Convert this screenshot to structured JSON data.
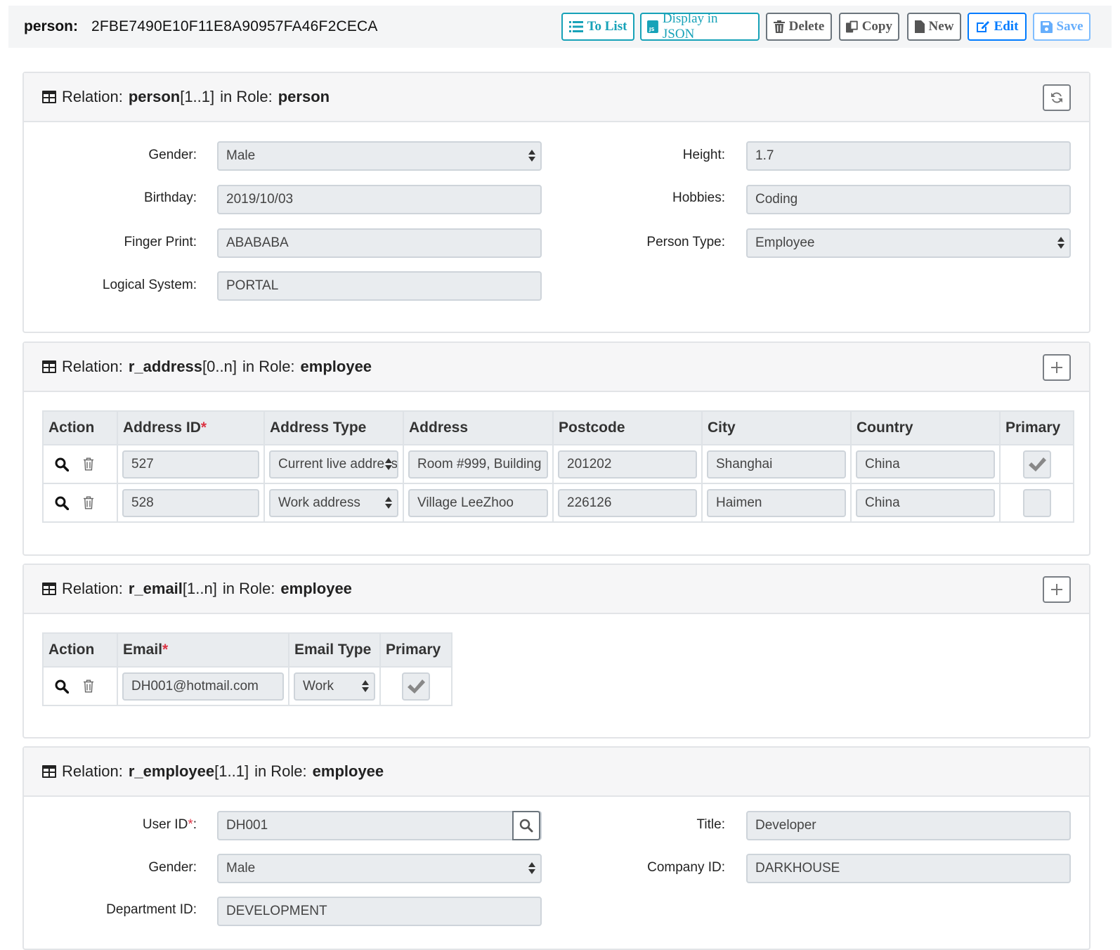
{
  "header": {
    "object_label": "person:",
    "object_id": "2FBE7490E10F11E8A90957FA46F2CECA",
    "buttons": {
      "to_list": "To List",
      "display_json": "Display in JSON",
      "delete": "Delete",
      "copy": "Copy",
      "new": "New",
      "edit": "Edit",
      "save": "Save"
    }
  },
  "relations": {
    "person": {
      "prefix": "Relation:",
      "name": "person",
      "cardinality": "[1..1]",
      "role_prefix": "in Role:",
      "role": "person",
      "fields": {
        "gender_label": "Gender:",
        "gender": "Male",
        "height_label": "Height:",
        "height": "1.7",
        "birthday_label": "Birthday:",
        "birthday": "2019/10/03",
        "hobbies_label": "Hobbies:",
        "hobbies": "Coding",
        "finger_print_label": "Finger Print:",
        "finger_print": "ABABABA",
        "person_type_label": "Person Type:",
        "person_type": "Employee",
        "logical_system_label": "Logical System:",
        "logical_system": "PORTAL"
      }
    },
    "address": {
      "prefix": "Relation:",
      "name": "r_address",
      "cardinality": "[0..n]",
      "role_prefix": "in Role:",
      "role": "employee",
      "columns": {
        "action": "Action",
        "address_id": "Address ID",
        "address_type": "Address Type",
        "address": "Address",
        "postcode": "Postcode",
        "city": "City",
        "country": "Country",
        "primary": "Primary"
      },
      "required_mark": "*",
      "rows": [
        {
          "address_id": "527",
          "address_type": "Current live address",
          "address": "Room #999, Building",
          "postcode": "201202",
          "city": "Shanghai",
          "country": "China",
          "primary": true
        },
        {
          "address_id": "528",
          "address_type": "Work address",
          "address": "Village LeeZhoo",
          "postcode": "226126",
          "city": "Haimen",
          "country": "China",
          "primary": false
        }
      ]
    },
    "email": {
      "prefix": "Relation:",
      "name": "r_email",
      "cardinality": "[1..n]",
      "role_prefix": "in Role:",
      "role": "employee",
      "columns": {
        "action": "Action",
        "email": "Email",
        "email_type": "Email Type",
        "primary": "Primary"
      },
      "required_mark": "*",
      "rows": [
        {
          "email": "DH001@hotmail.com",
          "email_type": "Work",
          "primary": true
        }
      ]
    },
    "employee": {
      "prefix": "Relation:",
      "name": "r_employee",
      "cardinality": "[1..1]",
      "role_prefix": "in Role:",
      "role": "employee",
      "fields": {
        "user_id_label": "User ID",
        "user_id_required": "*",
        "user_id_colon": ":",
        "user_id": "DH001",
        "title_label": "Title:",
        "title": "Developer",
        "gender_label": "Gender:",
        "gender": "Male",
        "company_id_label": "Company ID:",
        "company_id": "DARKHOUSE",
        "department_id_label": "Department ID:",
        "department_id": "DEVELOPMENT"
      }
    }
  },
  "icons": {
    "table": "table-icon",
    "list": "list-icon",
    "json": "json-icon",
    "trash": "trash-icon",
    "copy": "copy-icon",
    "file": "file-icon",
    "edit": "edit-icon",
    "save": "floppy-icon",
    "refresh": "refresh-icon",
    "plus": "plus-icon",
    "search": "search-icon",
    "check": "check-icon"
  },
  "colors": {
    "info": "#17a2b8",
    "primary": "#007bff",
    "danger": "#dc3545",
    "secondary": "#6c757d"
  }
}
